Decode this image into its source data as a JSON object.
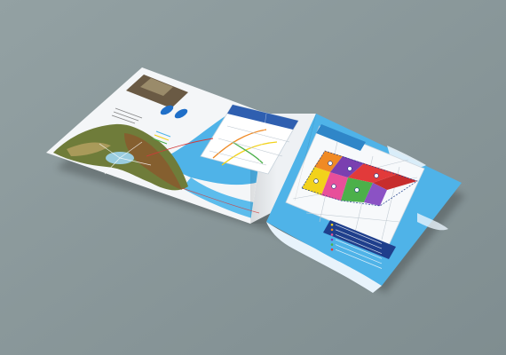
{
  "scene": {
    "subject": "brochure-mockup",
    "colors": {
      "background": "#8c9a9c",
      "paper": "#f4f6f8",
      "sea": "#4fb3e8",
      "sea_dark": "#2f86c8",
      "navy": "#1f3f8c",
      "land_green": "#6f7c3a",
      "land_brown": "#8a5a2e",
      "plot_yellow": "#f2d21b",
      "plot_orange": "#f08a24",
      "plot_red": "#e23a3a",
      "plot_purple": "#7a3fb0",
      "plot_green": "#4cb04a",
      "plot_pink": "#e84f9a",
      "route_red": "#d23b3b"
    },
    "legend_rows": 6,
    "label_text": ""
  }
}
